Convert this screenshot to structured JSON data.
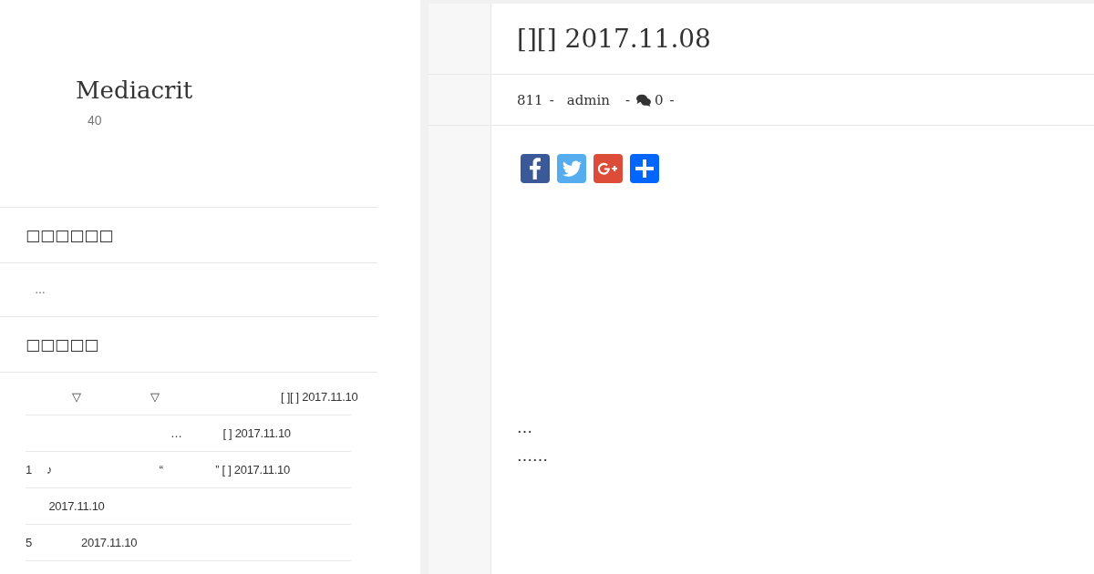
{
  "site": {
    "title": "Mediacrit",
    "description": "40"
  },
  "widgets": [
    {
      "kind": "text",
      "title": "□□□□□□",
      "text": "…"
    },
    {
      "kind": "list",
      "title": "□□□□□",
      "items": [
        "    ▽      ▽            [ ][ ] 2017.11.10",
        "              …     [ ] 2017.11.10",
        "1  ♪          “      ” [ ] 2017.11.10",
        "  2017.11.10",
        "5     2017.11.10"
      ]
    }
  ],
  "post": {
    "title": "[][] 2017.11.08",
    "meta": [
      {
        "kind": "views",
        "text": "811"
      },
      {
        "kind": "separator",
        "text": "-"
      },
      {
        "kind": "author",
        "text": "admin"
      },
      {
        "kind": "separator",
        "text": "-"
      },
      {
        "kind": "comments",
        "text": "0"
      },
      {
        "kind": "separator",
        "text": "-"
      }
    ],
    "share_buttons": [
      {
        "kind": "facebook",
        "color": "#3b5998"
      },
      {
        "kind": "twitter",
        "color": "#55acee"
      },
      {
        "kind": "google_plus",
        "color": "#dd4b39"
      },
      {
        "kind": "share",
        "color": "#0166ff"
      }
    ],
    "paragraphs": [
      "…",
      "……"
    ]
  }
}
